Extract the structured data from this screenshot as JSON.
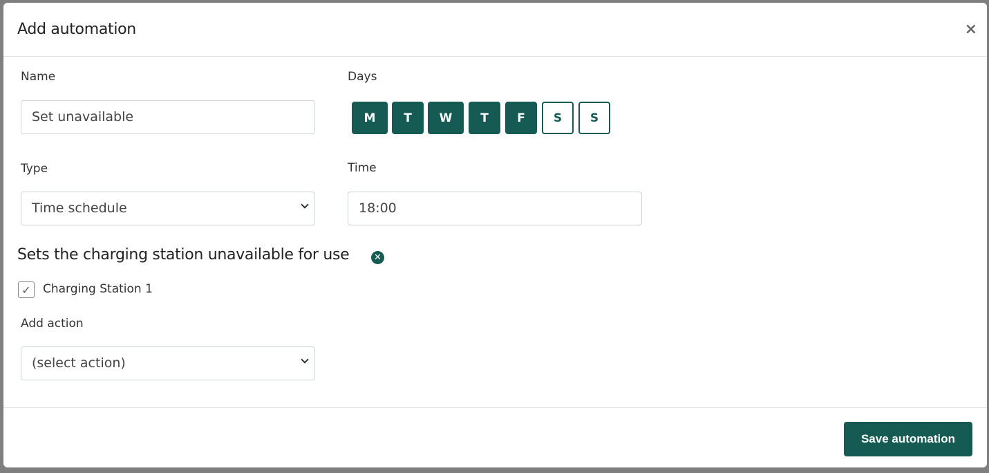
{
  "dialog": {
    "title": "Add automation",
    "close_icon": "close-icon",
    "name_label": "Name",
    "name_value": "Set unavailable",
    "days_label": "Days",
    "days": [
      {
        "label": "M",
        "selected": true
      },
      {
        "label": "T",
        "selected": true
      },
      {
        "label": "W",
        "selected": true
      },
      {
        "label": "T",
        "selected": true
      },
      {
        "label": "F",
        "selected": true
      },
      {
        "label": "S",
        "selected": false
      },
      {
        "label": "S",
        "selected": false
      }
    ],
    "type_label": "Type",
    "type_value": "Time schedule",
    "time_label": "Time",
    "time_value": "18:00",
    "action_title": "Sets the charging station unavailable for use",
    "station_label": "Charging Station 1",
    "station_checked": true,
    "add_action_label": "Add action",
    "add_action_value": "(select action)",
    "save_label": "Save automation",
    "accent_color": "#165a54"
  }
}
